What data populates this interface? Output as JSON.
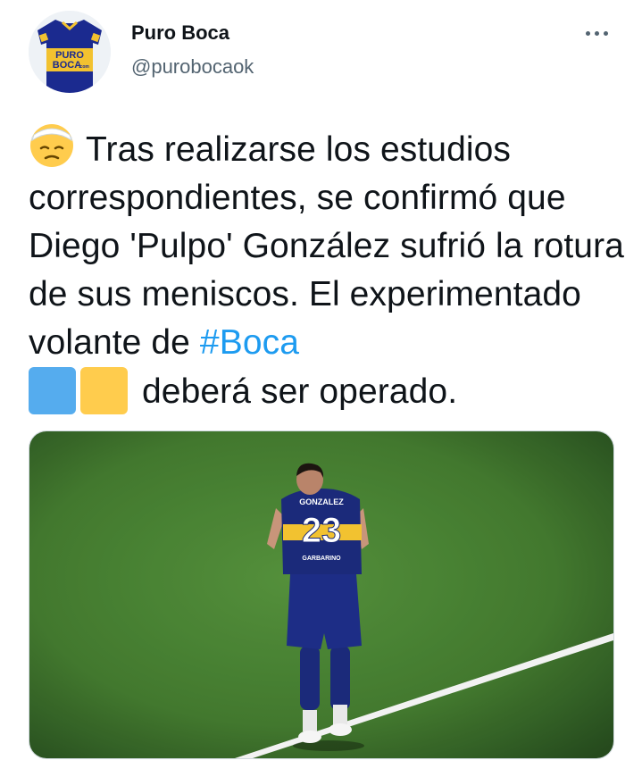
{
  "author": {
    "name": "Puro Boca",
    "handle": "@purobocaok",
    "avatar_text_1": "PURO",
    "avatar_text_2": "BOCA",
    "avatar_text_3": ".com"
  },
  "menu": {
    "icon": "more-horizontal-icon"
  },
  "tweet": {
    "emoji": "face-with-head-bandage-emoji",
    "text_part1": "Tras realizarse los estudios correspondientes, se confirmó que Diego 'Pulpo' González sufrió la rotura de sus meniscos. El experimentado volante de ",
    "hashtag": "#Boca",
    "emoji_squares": [
      "blue-square-emoji",
      "yellow-square-emoji"
    ],
    "text_part2": "deberá ser operado."
  },
  "media": {
    "jersey_name": "GONZALEZ",
    "jersey_number": "23",
    "sponsor": "GARBARINO"
  },
  "colors": {
    "link": "#1d9bf0",
    "secondary_text": "#536471",
    "boca_blue": "#1b2a7a",
    "boca_yellow": "#f2c230",
    "pitch_green": "#3f7a2a"
  }
}
